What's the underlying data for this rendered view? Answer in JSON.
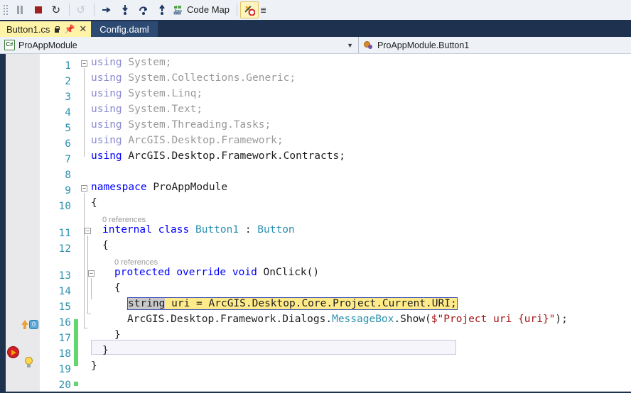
{
  "toolbar": {
    "buttons": [
      {
        "name": "pause-button",
        "icon": "pause-icon",
        "label": ""
      },
      {
        "name": "stop-debugging-button",
        "icon": "stop-icon",
        "label": ""
      },
      {
        "name": "restart-button",
        "icon": "restart-icon",
        "label": ""
      },
      {
        "name": "refresh-button",
        "icon": "refresh-icon",
        "label": ""
      },
      {
        "name": "show-next-statement-button",
        "icon": "arrow-right-icon",
        "label": ""
      },
      {
        "name": "step-into-button",
        "icon": "step-into-icon",
        "label": ""
      },
      {
        "name": "step-over-button",
        "icon": "step-over-icon",
        "label": ""
      },
      {
        "name": "step-out-button",
        "icon": "step-out-icon",
        "label": ""
      }
    ],
    "code_map_label": "Code Map",
    "exception_toggle_name": "break-on-exception-toggle",
    "overflow_label": "≡"
  },
  "tabs": [
    {
      "label": "Button1.cs",
      "active": true,
      "lock_icon": "lock-icon",
      "pin_icon": "pin-icon",
      "close_icon": "close-icon"
    },
    {
      "label": "Config.daml",
      "active": false
    }
  ],
  "navbar": {
    "type_dropdown": "ProAppModule",
    "member_dropdown": "ProAppModule.Button1",
    "dropdown_arrow": "▼"
  },
  "editor": {
    "lens_class": "0 references",
    "lens_method": "0 references",
    "lines": [
      {
        "n": "1",
        "text": "using System;"
      },
      {
        "n": "2",
        "text": "using System.Collections.Generic;"
      },
      {
        "n": "3",
        "text": "using System.Linq;"
      },
      {
        "n": "4",
        "text": "using System.Text;"
      },
      {
        "n": "5",
        "text": "using System.Threading.Tasks;"
      },
      {
        "n": "6",
        "text": "using ArcGIS.Desktop.Framework;"
      },
      {
        "n": "7",
        "text": "using ArcGIS.Desktop.Framework.Contracts;"
      },
      {
        "n": "8",
        "text": ""
      },
      {
        "n": "9",
        "text": "namespace ProAppModule"
      },
      {
        "n": "10",
        "text": "{"
      },
      {
        "n": "11",
        "text": "    internal class Button1 : Button"
      },
      {
        "n": "12",
        "text": "    {"
      },
      {
        "n": "13",
        "text": "        protected override void OnClick()"
      },
      {
        "n": "14",
        "text": "        {"
      },
      {
        "n": "15",
        "text": "            string uri = ArcGIS.Desktop.Core.Project.Current.URI;"
      },
      {
        "n": "16",
        "text": "            ArcGIS.Desktop.Framework.Dialogs.MessageBox.Show($\"Project uri {uri}\");"
      },
      {
        "n": "17",
        "text": "        }"
      },
      {
        "n": "18",
        "text": "    }"
      },
      {
        "n": "19",
        "text": "}"
      },
      {
        "n": "20",
        "text": ""
      }
    ],
    "tokens": {
      "kw_using": "using",
      "ns_system": "System;",
      "ns_collections": "System.Collections.Generic;",
      "ns_linq": "System.Linq;",
      "ns_text": "System.Text;",
      "ns_threading": "System.Threading.Tasks;",
      "ns_framework": "ArcGIS.Desktop.Framework;",
      "ns_contracts": "ArcGIS.Desktop.Framework.Contracts;",
      "kw_namespace": "namespace",
      "name_namespace": "ProAppModule",
      "brace_open": "{",
      "brace_close": "}",
      "kw_internal": "internal",
      "kw_class": "class",
      "name_class": "Button1",
      "colon": ":",
      "base_class": "Button",
      "kw_protected": "protected",
      "kw_override": "override",
      "kw_void": "void",
      "name_method": "OnClick()",
      "kw_string": "string",
      "expr_assign": " uri = ArcGIS.Desktop.Core.Project.Current.URI;",
      "call_prefix": "ArcGIS.Desktop.Framework.Dialogs.",
      "call_type": "MessageBox",
      "call_method": ".Show(",
      "interp_str": "$\"Project uri {uri}\"",
      "call_suffix": ");"
    },
    "glyphs": {
      "breakpoint": "breakpoint-icon",
      "lightbulb": "lightbulb-icon",
      "overrides": "overrides-icon",
      "overrides_count": "0"
    },
    "colors": {
      "keyword": "#0000ff",
      "type": "#2b91af",
      "string": "#a31515",
      "dimmed": "#9a9a9a",
      "linenumber": "#2b91af",
      "highlight_bg": "#ffeb8a",
      "highlight_border": "#3b4fb8",
      "changebar": "#61d86b",
      "tab_active_bg": "#fff3a8",
      "chrome_bg": "#1e3250"
    }
  }
}
